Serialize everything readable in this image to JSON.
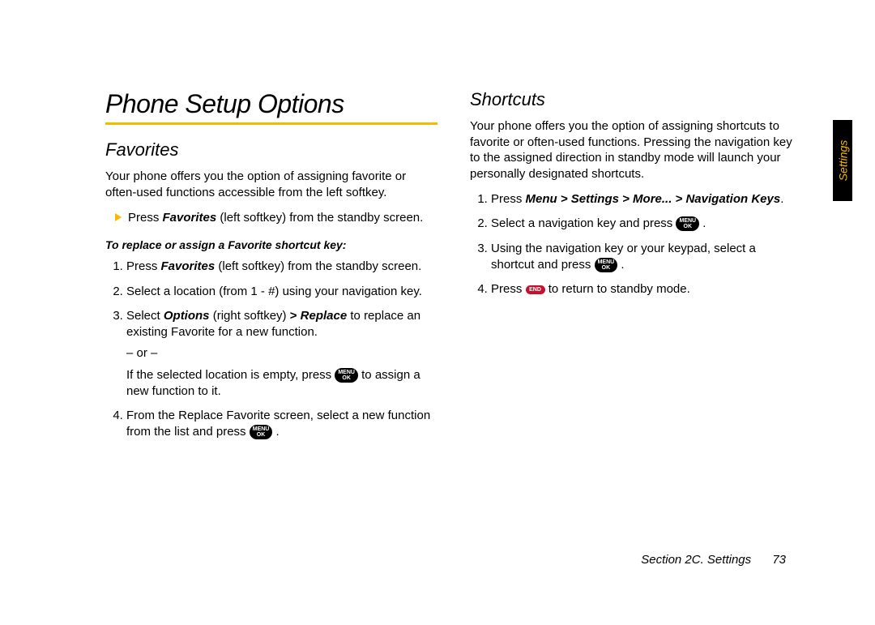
{
  "pageTitle": "Phone Setup Options",
  "favorites": {
    "heading": "Favorites",
    "intro": "Your phone offers you the option of assigning favorite or often-used functions accessible from the left softkey.",
    "bullet": {
      "pre": "Press ",
      "bi": "Favorites",
      "post": " (left softkey) from the standby screen."
    },
    "subhead": "To replace or assign a Favorite shortcut key:",
    "steps": {
      "s1": {
        "pre": "Press ",
        "bi": "Favorites",
        "post": " (left softkey) from the standby screen."
      },
      "s2": "Select a location (from 1 - #) using your navigation key.",
      "s3": {
        "pre": "Select ",
        "bi1": "Options",
        "mid1": " (right softkey) ",
        "gt": ">",
        "bi2": "Replace",
        "post": " to replace an existing Favorite for a new function."
      },
      "or": "– or –",
      "s3b": {
        "pre": "If the selected location is empty, press ",
        "post": " to assign a new function to it."
      },
      "s4": {
        "pre": "From the Replace Favorite screen, select a new function from the list and press ",
        "post": "."
      }
    }
  },
  "shortcuts": {
    "heading": "Shortcuts",
    "intro": "Your phone offers you the option of assigning shortcuts to favorite or often-used functions. Pressing the navigation key to the assigned direction in standby mode will launch your personally designated shortcuts.",
    "steps": {
      "s1": {
        "pre": "Press ",
        "bi": "Menu > Settings > More... > Navigation Keys",
        "post": "."
      },
      "s2": {
        "pre": "Select a navigation key and press ",
        "post": "."
      },
      "s3": {
        "pre": "Using the navigation key or your keypad, select a shortcut and press ",
        "post": "."
      },
      "s4": {
        "pre": "Press ",
        "post": " to return to standby mode."
      }
    }
  },
  "keys": {
    "menuOk": {
      "line1": "MENU",
      "line2": "OK"
    },
    "end": {
      "line1": "END",
      "line2": ""
    }
  },
  "footer": {
    "section": "Section 2C. Settings",
    "page": "73"
  },
  "sideTab": "Settings"
}
